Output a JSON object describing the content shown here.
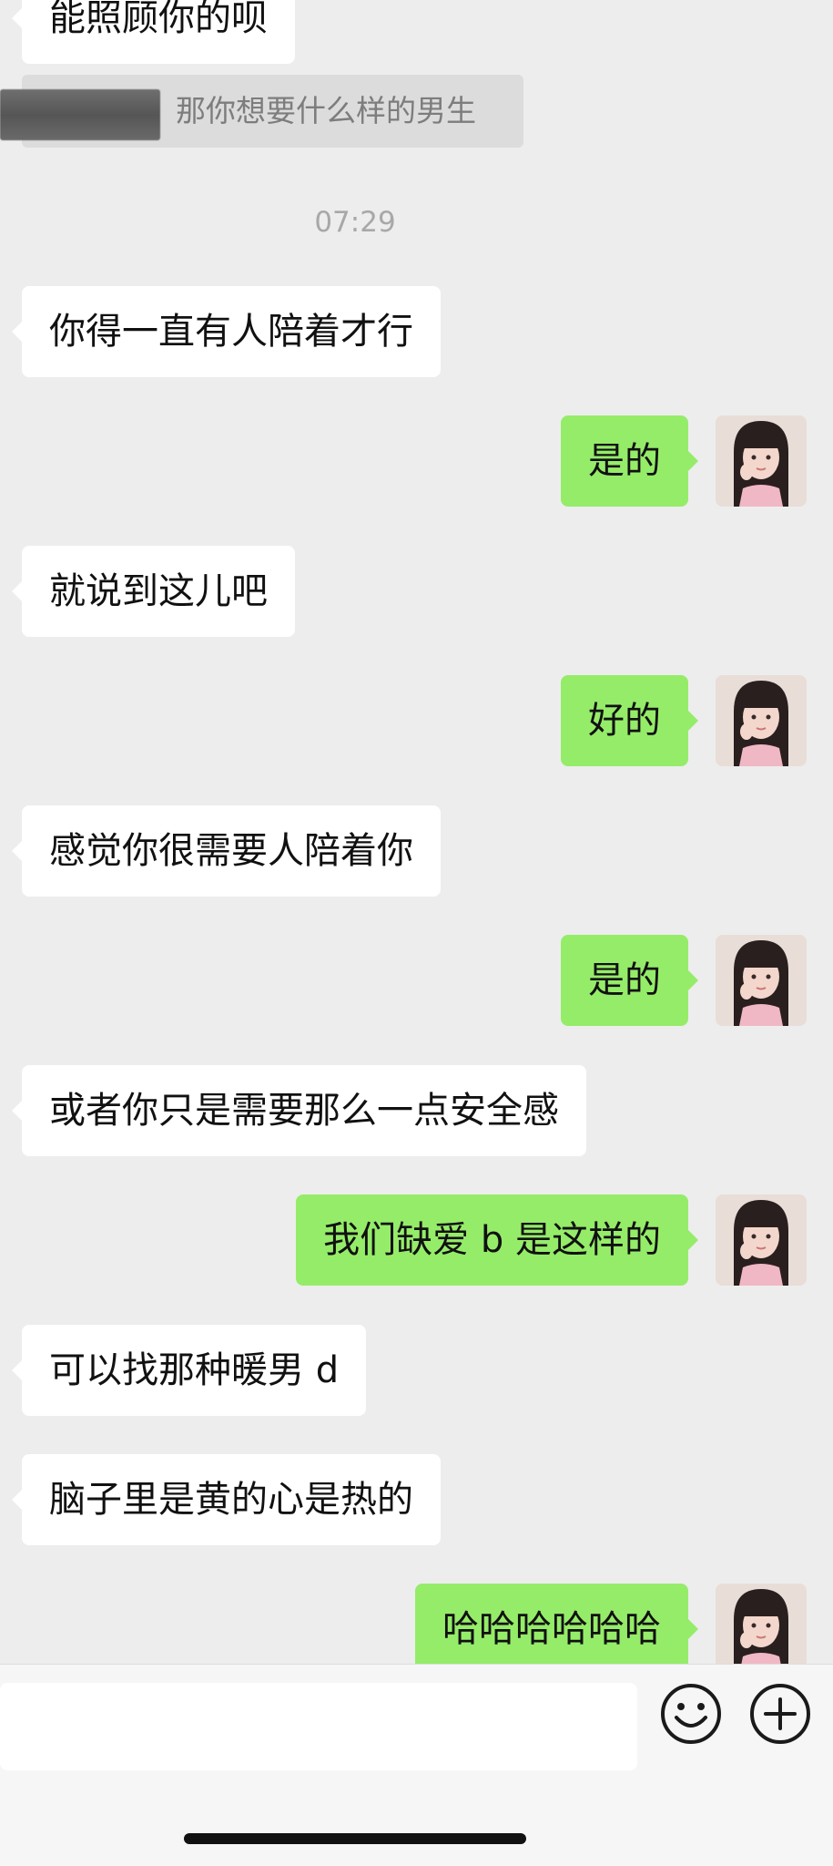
{
  "quoted_reply": {
    "text": "那你想要什么样的男生"
  },
  "timestamp": "07:29",
  "messages": {
    "m0": "能照顾你的呗",
    "m1": "你得一直有人陪着才行",
    "m2": "是的",
    "m3": "就说到这儿吧",
    "m4": "好的",
    "m5": "感觉你很需要人陪着你",
    "m6": "是的",
    "m7": "或者你只是需要那么一点安全感",
    "m8": "我们缺爱 b 是这样的",
    "m9": "可以找那种暖男 d",
    "m10": "脑子里是黄的心是热的",
    "m11": "哈哈哈哈哈哈"
  },
  "input": {
    "placeholder": ""
  },
  "icons": {
    "emoji": "emoji-icon",
    "add": "plus-circle-icon"
  },
  "colors": {
    "outgoing_bubble": "#95ec69",
    "incoming_bubble": "#ffffff",
    "background": "#ededed"
  }
}
